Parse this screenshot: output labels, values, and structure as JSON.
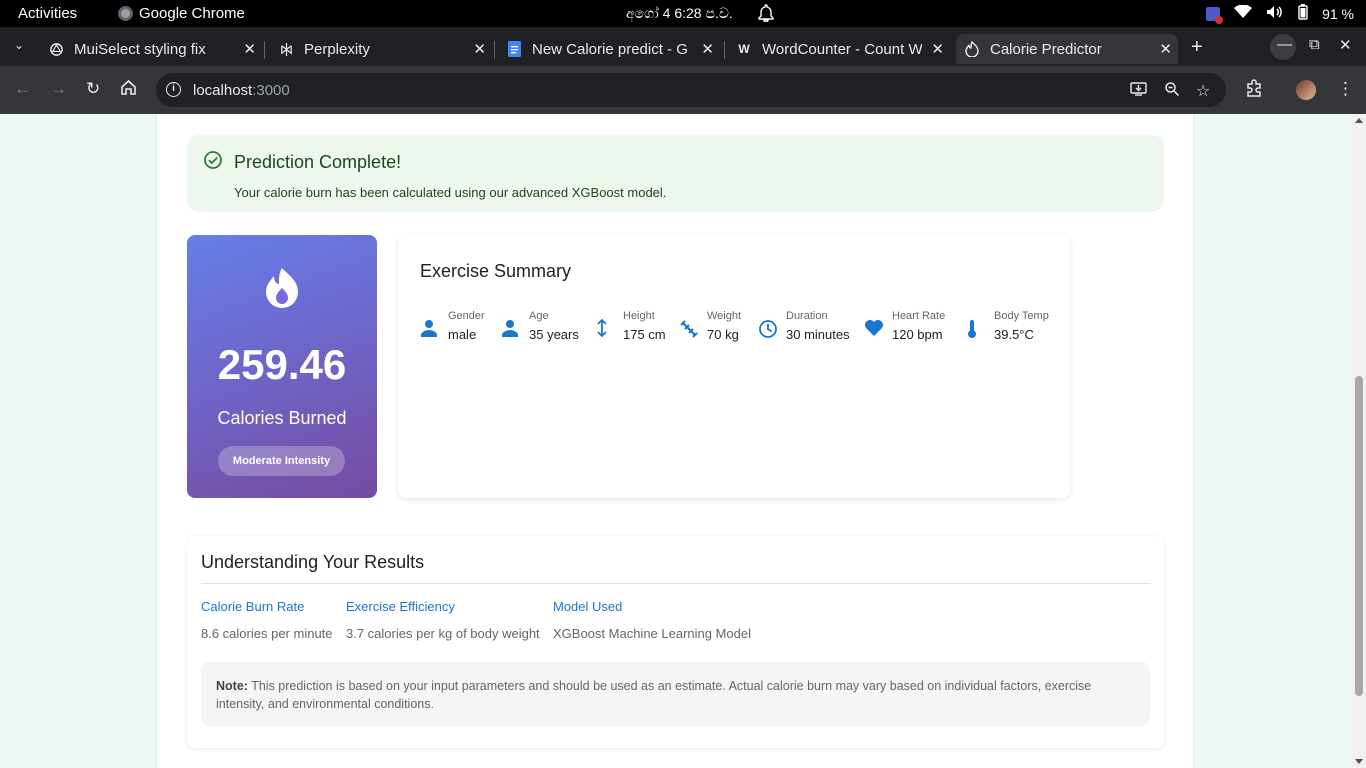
{
  "system": {
    "activities": "Activities",
    "app_name": "Google Chrome",
    "clock": "අගෝ 4   6:28 ප.ව.",
    "battery": "91 %"
  },
  "tabs": [
    {
      "title": "MuiSelect styling fix",
      "icon": "openai-icon"
    },
    {
      "title": "Perplexity",
      "icon": "perplexity-icon"
    },
    {
      "title": "New Calorie predict - G",
      "icon": "docs-icon"
    },
    {
      "title": "WordCounter - Count W",
      "icon": "w-icon"
    },
    {
      "title": "Calorie Predictor",
      "icon": "flame-favicon"
    }
  ],
  "omnibox": {
    "host": "localhost",
    "port": ":3000"
  },
  "alert": {
    "title": "Prediction Complete!",
    "message": "Your calorie burn has been calculated using our advanced XGBoost model."
  },
  "result": {
    "calories": "259.46",
    "label": "Calories Burned",
    "intensity": "Moderate Intensity"
  },
  "summary": {
    "title": "Exercise Summary",
    "items": [
      {
        "key": "Gender",
        "value": "male",
        "icon": "person-icon"
      },
      {
        "key": "Age",
        "value": "35 years",
        "icon": "person-icon"
      },
      {
        "key": "Height",
        "value": "175 cm",
        "icon": "height-icon"
      },
      {
        "key": "Weight",
        "value": "70 kg",
        "icon": "fitness-icon"
      },
      {
        "key": "Duration",
        "value": "30 minutes",
        "icon": "clock-icon"
      },
      {
        "key": "Heart Rate",
        "value": "120 bpm",
        "icon": "heart-icon"
      },
      {
        "key": "Body Temp",
        "value": "39.5°C",
        "icon": "thermometer-icon"
      }
    ]
  },
  "understanding": {
    "title": "Understanding Your Results",
    "columns": [
      {
        "heading": "Calorie Burn Rate",
        "detail": "8.6 calories per minute"
      },
      {
        "heading": "Exercise Efficiency",
        "detail": "3.7 calories per kg of body weight"
      },
      {
        "heading": "Model Used",
        "detail": "XGBoost Machine Learning Model"
      }
    ],
    "note_label": "Note:",
    "note_text": " This prediction is based on your input parameters and should be used as an estimate. Actual calorie burn may vary based on individual factors, exercise intensity, and environmental conditions."
  },
  "colors": {
    "accent": "#1976d2",
    "success_bg": "#edf7ed",
    "gradient_start": "#667eea",
    "gradient_end": "#764ba2"
  }
}
